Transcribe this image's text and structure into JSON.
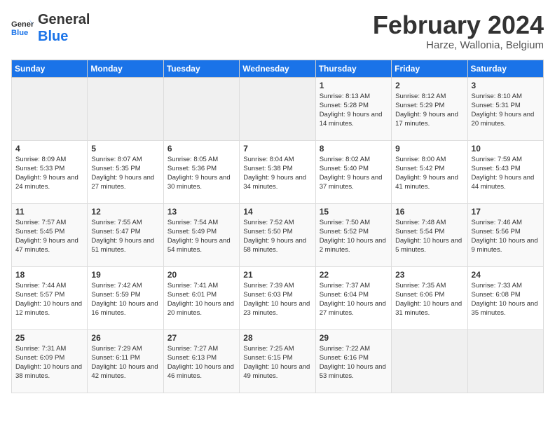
{
  "header": {
    "logo_line1": "General",
    "logo_line2": "Blue",
    "month": "February 2024",
    "location": "Harze, Wallonia, Belgium"
  },
  "weekdays": [
    "Sunday",
    "Monday",
    "Tuesday",
    "Wednesday",
    "Thursday",
    "Friday",
    "Saturday"
  ],
  "weeks": [
    [
      {
        "day": "",
        "info": ""
      },
      {
        "day": "",
        "info": ""
      },
      {
        "day": "",
        "info": ""
      },
      {
        "day": "",
        "info": ""
      },
      {
        "day": "1",
        "info": "Sunrise: 8:13 AM\nSunset: 5:28 PM\nDaylight: 9 hours and 14 minutes."
      },
      {
        "day": "2",
        "info": "Sunrise: 8:12 AM\nSunset: 5:29 PM\nDaylight: 9 hours and 17 minutes."
      },
      {
        "day": "3",
        "info": "Sunrise: 8:10 AM\nSunset: 5:31 PM\nDaylight: 9 hours and 20 minutes."
      }
    ],
    [
      {
        "day": "4",
        "info": "Sunrise: 8:09 AM\nSunset: 5:33 PM\nDaylight: 9 hours and 24 minutes."
      },
      {
        "day": "5",
        "info": "Sunrise: 8:07 AM\nSunset: 5:35 PM\nDaylight: 9 hours and 27 minutes."
      },
      {
        "day": "6",
        "info": "Sunrise: 8:05 AM\nSunset: 5:36 PM\nDaylight: 9 hours and 30 minutes."
      },
      {
        "day": "7",
        "info": "Sunrise: 8:04 AM\nSunset: 5:38 PM\nDaylight: 9 hours and 34 minutes."
      },
      {
        "day": "8",
        "info": "Sunrise: 8:02 AM\nSunset: 5:40 PM\nDaylight: 9 hours and 37 minutes."
      },
      {
        "day": "9",
        "info": "Sunrise: 8:00 AM\nSunset: 5:42 PM\nDaylight: 9 hours and 41 minutes."
      },
      {
        "day": "10",
        "info": "Sunrise: 7:59 AM\nSunset: 5:43 PM\nDaylight: 9 hours and 44 minutes."
      }
    ],
    [
      {
        "day": "11",
        "info": "Sunrise: 7:57 AM\nSunset: 5:45 PM\nDaylight: 9 hours and 47 minutes."
      },
      {
        "day": "12",
        "info": "Sunrise: 7:55 AM\nSunset: 5:47 PM\nDaylight: 9 hours and 51 minutes."
      },
      {
        "day": "13",
        "info": "Sunrise: 7:54 AM\nSunset: 5:49 PM\nDaylight: 9 hours and 54 minutes."
      },
      {
        "day": "14",
        "info": "Sunrise: 7:52 AM\nSunset: 5:50 PM\nDaylight: 9 hours and 58 minutes."
      },
      {
        "day": "15",
        "info": "Sunrise: 7:50 AM\nSunset: 5:52 PM\nDaylight: 10 hours and 2 minutes."
      },
      {
        "day": "16",
        "info": "Sunrise: 7:48 AM\nSunset: 5:54 PM\nDaylight: 10 hours and 5 minutes."
      },
      {
        "day": "17",
        "info": "Sunrise: 7:46 AM\nSunset: 5:56 PM\nDaylight: 10 hours and 9 minutes."
      }
    ],
    [
      {
        "day": "18",
        "info": "Sunrise: 7:44 AM\nSunset: 5:57 PM\nDaylight: 10 hours and 12 minutes."
      },
      {
        "day": "19",
        "info": "Sunrise: 7:42 AM\nSunset: 5:59 PM\nDaylight: 10 hours and 16 minutes."
      },
      {
        "day": "20",
        "info": "Sunrise: 7:41 AM\nSunset: 6:01 PM\nDaylight: 10 hours and 20 minutes."
      },
      {
        "day": "21",
        "info": "Sunrise: 7:39 AM\nSunset: 6:03 PM\nDaylight: 10 hours and 23 minutes."
      },
      {
        "day": "22",
        "info": "Sunrise: 7:37 AM\nSunset: 6:04 PM\nDaylight: 10 hours and 27 minutes."
      },
      {
        "day": "23",
        "info": "Sunrise: 7:35 AM\nSunset: 6:06 PM\nDaylight: 10 hours and 31 minutes."
      },
      {
        "day": "24",
        "info": "Sunrise: 7:33 AM\nSunset: 6:08 PM\nDaylight: 10 hours and 35 minutes."
      }
    ],
    [
      {
        "day": "25",
        "info": "Sunrise: 7:31 AM\nSunset: 6:09 PM\nDaylight: 10 hours and 38 minutes."
      },
      {
        "day": "26",
        "info": "Sunrise: 7:29 AM\nSunset: 6:11 PM\nDaylight: 10 hours and 42 minutes."
      },
      {
        "day": "27",
        "info": "Sunrise: 7:27 AM\nSunset: 6:13 PM\nDaylight: 10 hours and 46 minutes."
      },
      {
        "day": "28",
        "info": "Sunrise: 7:25 AM\nSunset: 6:15 PM\nDaylight: 10 hours and 49 minutes."
      },
      {
        "day": "29",
        "info": "Sunrise: 7:22 AM\nSunset: 6:16 PM\nDaylight: 10 hours and 53 minutes."
      },
      {
        "day": "",
        "info": ""
      },
      {
        "day": "",
        "info": ""
      }
    ]
  ]
}
